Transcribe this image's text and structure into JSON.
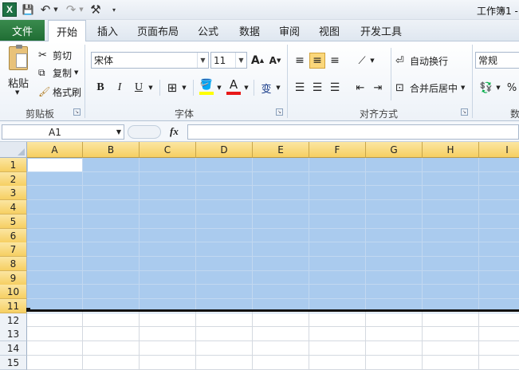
{
  "window": {
    "title": "工作簿1 -",
    "logo": "X"
  },
  "quick_access": {
    "save_icon": "💾",
    "undo_icon": "↶",
    "redo_icon": "↷",
    "tool_icon": "⚒"
  },
  "tabs": [
    {
      "label": "文件"
    },
    {
      "label": "开始"
    },
    {
      "label": "插入"
    },
    {
      "label": "页面布局"
    },
    {
      "label": "公式"
    },
    {
      "label": "数据"
    },
    {
      "label": "审阅"
    },
    {
      "label": "视图"
    },
    {
      "label": "开发工具"
    }
  ],
  "clipboard": {
    "paste": "粘贴",
    "cut": "剪切",
    "copy": "复制",
    "format_painter": "格式刷",
    "group": "剪贴板"
  },
  "font": {
    "name": "宋体",
    "size": "11",
    "bold": "B",
    "italic": "I",
    "underline": "U",
    "grow": "A",
    "shrink": "A",
    "font_color_letter": "A",
    "wen_glyph": "变",
    "group": "字体"
  },
  "alignment": {
    "wrap_text": "自动换行",
    "merge_center": "合并后居中",
    "group": "对齐方式"
  },
  "number": {
    "format": "常规",
    "percent": "%",
    "group": "数"
  },
  "formula_bar": {
    "name_box": "A1",
    "fx": "fx",
    "value": ""
  },
  "sheet": {
    "columns": [
      "A",
      "B",
      "C",
      "D",
      "E",
      "F",
      "G",
      "H",
      "I"
    ],
    "rows": [
      "1",
      "2",
      "3",
      "4",
      "5",
      "6",
      "7",
      "8",
      "9",
      "10",
      "11",
      "12",
      "13",
      "14",
      "15"
    ],
    "selection": "A1:I11",
    "active_cell": "A1"
  },
  "colors": {
    "selection": "#aacbee",
    "header_selected": "#f6cf62",
    "file_tab": "#2a7d40",
    "font_color": "#e81818",
    "highlight": "#ffff00"
  }
}
